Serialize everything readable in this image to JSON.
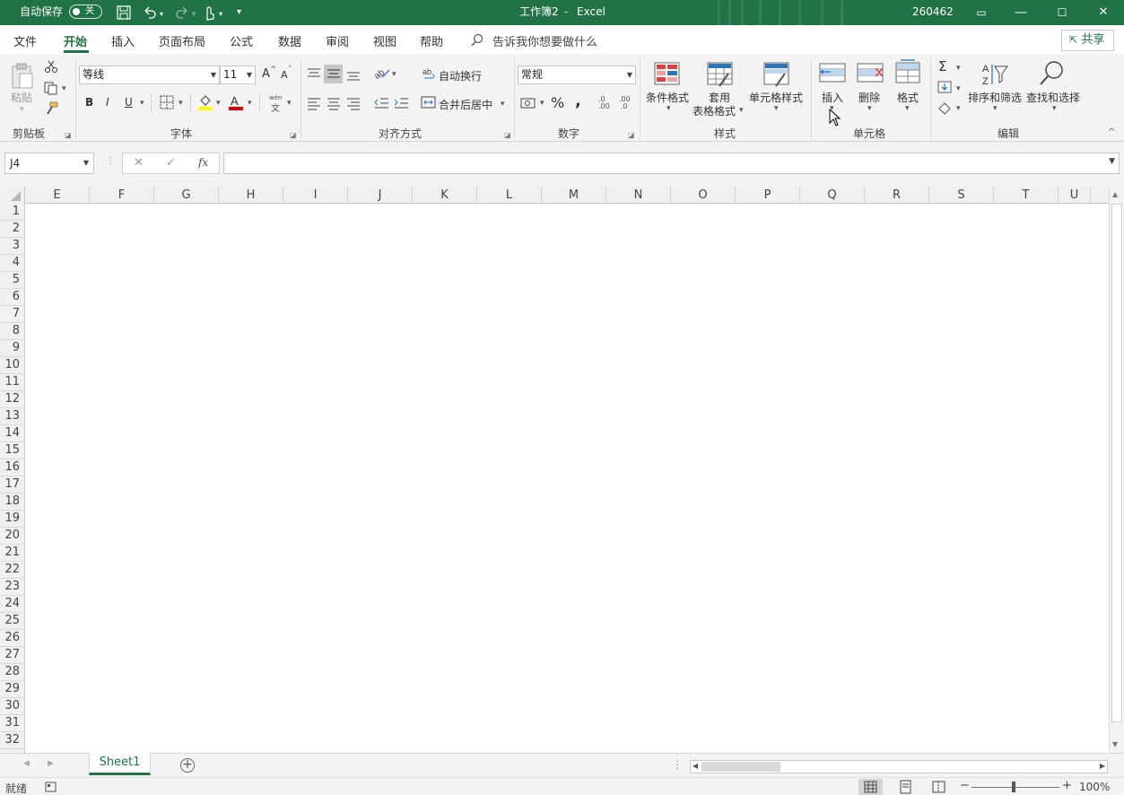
{
  "titlebar": {
    "autosave_label": "自动保存",
    "autosave_state": "关",
    "doc_title": "工作簿2",
    "separator": "-",
    "app_name": "Excel",
    "user_id": "260462",
    "minimize_glyph": "—",
    "restore_glyph": "▭",
    "maximize_glyph": "☐",
    "close_glyph": "✕",
    "qat_more": "▾"
  },
  "menu": {
    "items": [
      "文件",
      "开始",
      "插入",
      "页面布局",
      "公式",
      "数据",
      "审阅",
      "视图",
      "帮助"
    ],
    "active": "开始",
    "tell_me": "告诉我你想要做什么",
    "share": "共享"
  },
  "ribbon": {
    "clipboard": {
      "paste": "粘贴",
      "label": "剪贴板"
    },
    "font": {
      "name": "等线",
      "size": "11",
      "bold": "B",
      "italic": "I",
      "underline": "U",
      "label": "字体",
      "grow": "A",
      "shrink": "A",
      "phonetic_top": "wén",
      "phonetic_bottom": "文"
    },
    "alignment": {
      "wrap": "自动换行",
      "merge": "合并后居中",
      "label": "对齐方式"
    },
    "number": {
      "format": "常规",
      "percent": "%",
      "comma": ",",
      "label": "数字",
      "inc_decimal": ".00",
      "dec_decimal": ".0"
    },
    "styles": {
      "conditional": "条件格式",
      "table_top": "套用",
      "table_bottom": "表格格式",
      "cell_styles": "单元格样式",
      "label": "样式"
    },
    "cells": {
      "insert": "插入",
      "delete": "删除",
      "format": "格式",
      "label": "单元格"
    },
    "editing": {
      "sort": "排序和筛选",
      "find": "查找和选择",
      "label": "编辑",
      "sigma": "Σ"
    }
  },
  "formula_bar": {
    "name_box": "J4",
    "cancel": "✕",
    "enter": "✓",
    "fx": "fx",
    "value": ""
  },
  "grid": {
    "columns": [
      "E",
      "F",
      "G",
      "H",
      "I",
      "J",
      "K",
      "L",
      "M",
      "N",
      "O",
      "P",
      "Q",
      "R",
      "S",
      "T",
      "U"
    ],
    "rows": [
      "1",
      "2",
      "3",
      "4",
      "5",
      "6",
      "7",
      "8",
      "9",
      "10",
      "11",
      "12",
      "13",
      "14",
      "15",
      "16",
      "17",
      "18",
      "19",
      "20",
      "21",
      "22",
      "23",
      "24",
      "25",
      "26",
      "27",
      "28",
      "29",
      "30",
      "31",
      "32"
    ]
  },
  "sheets": {
    "tabs": [
      "Sheet1"
    ],
    "add": "+"
  },
  "status": {
    "ready": "就绪",
    "zoom": "100%",
    "zoom_minus": "−",
    "zoom_plus": "+"
  },
  "colors": {
    "accent": "#217346",
    "ribbon_bg": "#f3f3f3",
    "header_bg": "#f0f0f0"
  }
}
